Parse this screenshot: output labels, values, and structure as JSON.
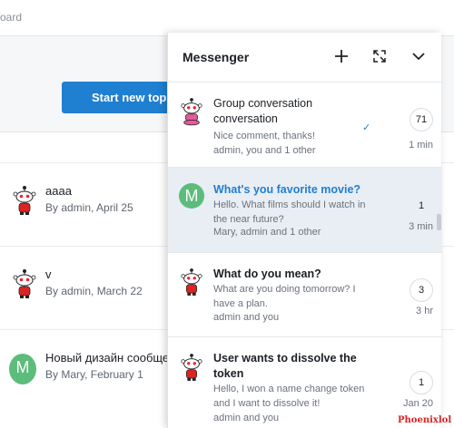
{
  "page": {
    "breadcrumb": "oard",
    "start_button": "Start new topic",
    "threads": [
      {
        "title": "aaaa",
        "meta": "By admin, April 25",
        "avatar": "robot-avatar"
      },
      {
        "title": "v",
        "meta": "By admin, March 22",
        "avatar": "robot-avatar"
      },
      {
        "title": "Новый дизайн сообщест",
        "meta": "By Mary, February 1",
        "avatar_letter": "M"
      }
    ]
  },
  "messenger": {
    "title": "Messenger",
    "icons": [
      "plus-icon",
      "expand-icon",
      "chevron-down-icon"
    ],
    "conversations": [
      {
        "title": "Group conversation conversation",
        "preview": "Nice comment, thanks!",
        "participants": "admin, you and 1 other",
        "count": "71",
        "time": "1 min",
        "read_check": "✓",
        "avatar": "robot-avatar-pink"
      },
      {
        "title": "What's you favorite movie?",
        "preview": "Hello. What films should I watch in the near future?",
        "participants": "Mary, admin and 1 other",
        "count": "1",
        "time": "3 min",
        "avatar_letter": "M"
      },
      {
        "title": "What do you mean?",
        "preview": "What are you doing tomorrow? I have a plan.",
        "participants": "admin and you",
        "count": "3",
        "time": "3 hr",
        "avatar": "robot-avatar"
      },
      {
        "title": "User wants to dissolve the token",
        "preview": "Hello, I won a name change token and I want to dissolve it!",
        "participants": "admin and you",
        "count": "1",
        "time": "Jan 20",
        "avatar": "robot-avatar"
      }
    ]
  },
  "watermark": "Phoenixlol",
  "colors": {
    "accent": "#1f7fd1",
    "active_row": "#e9eef4",
    "avatar_green": "#5cbc7b"
  }
}
